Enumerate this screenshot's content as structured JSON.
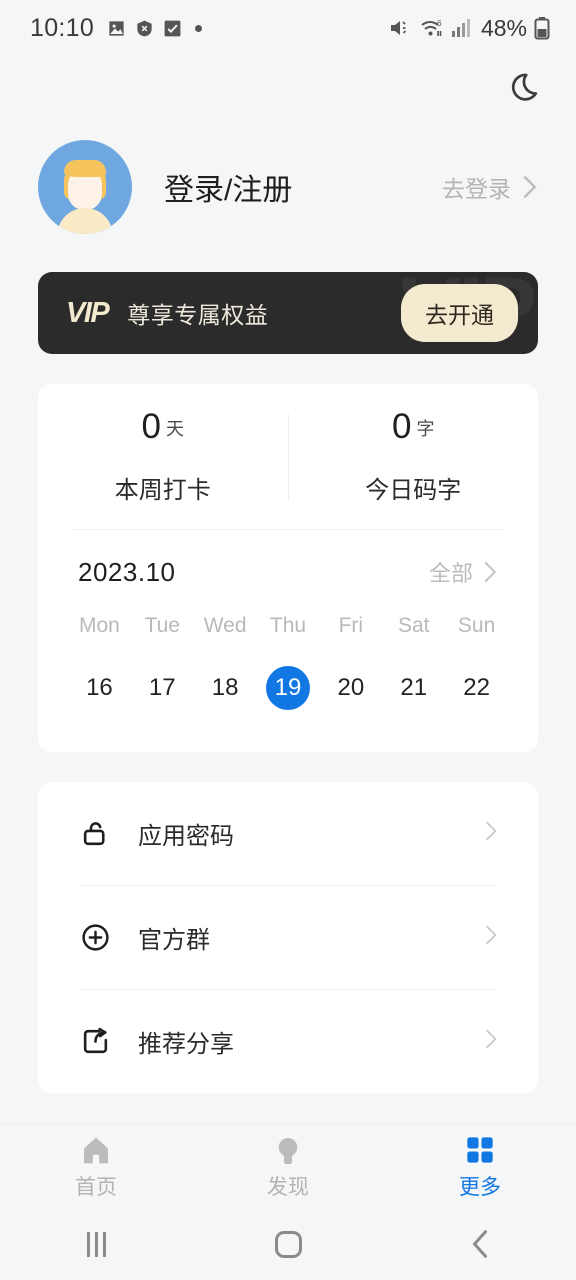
{
  "status_bar": {
    "time": "10:10",
    "notification_icons": [
      "image-icon",
      "shield-x-icon",
      "checkbox-checked-icon",
      "dot-icon"
    ],
    "mute_icon": "volume-mute-icon",
    "wifi_icon": "wifi-6-icon",
    "signal_icon": "cellular-signal-icon",
    "battery_percent": "48%",
    "battery_icon": "battery-icon"
  },
  "top_bar": {
    "theme_toggle_icon": "moon-icon"
  },
  "profile": {
    "avatar_icon": "user-avatar",
    "name": "登录/注册",
    "action_label": "去登录",
    "action_chevron": "chevron-right-icon"
  },
  "vip_banner": {
    "logo": "VIP",
    "watermark": "VIP",
    "slogan": "尊享专属权益",
    "button_label": "去开通",
    "bg_color": "#2b2b2b",
    "accent_color": "#f4ead0"
  },
  "stats": [
    {
      "value": "0",
      "unit": "天",
      "label": "本周打卡"
    },
    {
      "value": "0",
      "unit": "字",
      "label": "今日码字"
    }
  ],
  "calendar": {
    "month": "2023.10",
    "all_label": "全部",
    "all_chevron": "chevron-right-icon",
    "weekdays": [
      "Mon",
      "Tue",
      "Wed",
      "Thu",
      "Fri",
      "Sat",
      "Sun"
    ],
    "days": [
      "16",
      "17",
      "18",
      "19",
      "20",
      "21",
      "22"
    ],
    "selected_day": "19",
    "selected_color": "#1178e3"
  },
  "menu": [
    {
      "icon": "unlock-icon",
      "label": "应用密码",
      "chevron": "chevron-right-icon"
    },
    {
      "icon": "plus-circle-icon",
      "label": "官方群",
      "chevron": "chevron-right-icon"
    },
    {
      "icon": "share-export-icon",
      "label": "推荐分享",
      "chevron": "chevron-right-icon"
    }
  ],
  "tab_bar": {
    "active_color": "#1178e3",
    "inactive_color": "#b3b3b5",
    "tabs": [
      {
        "icon": "home-icon",
        "label": "首页",
        "active": false
      },
      {
        "icon": "lightbulb-icon",
        "label": "发现",
        "active": false
      },
      {
        "icon": "grid-icon",
        "label": "更多",
        "active": true
      }
    ]
  },
  "android_nav": {
    "recents_icon": "recents-icon",
    "home_icon": "home-circle-icon",
    "back_icon": "back-chevron-icon"
  }
}
